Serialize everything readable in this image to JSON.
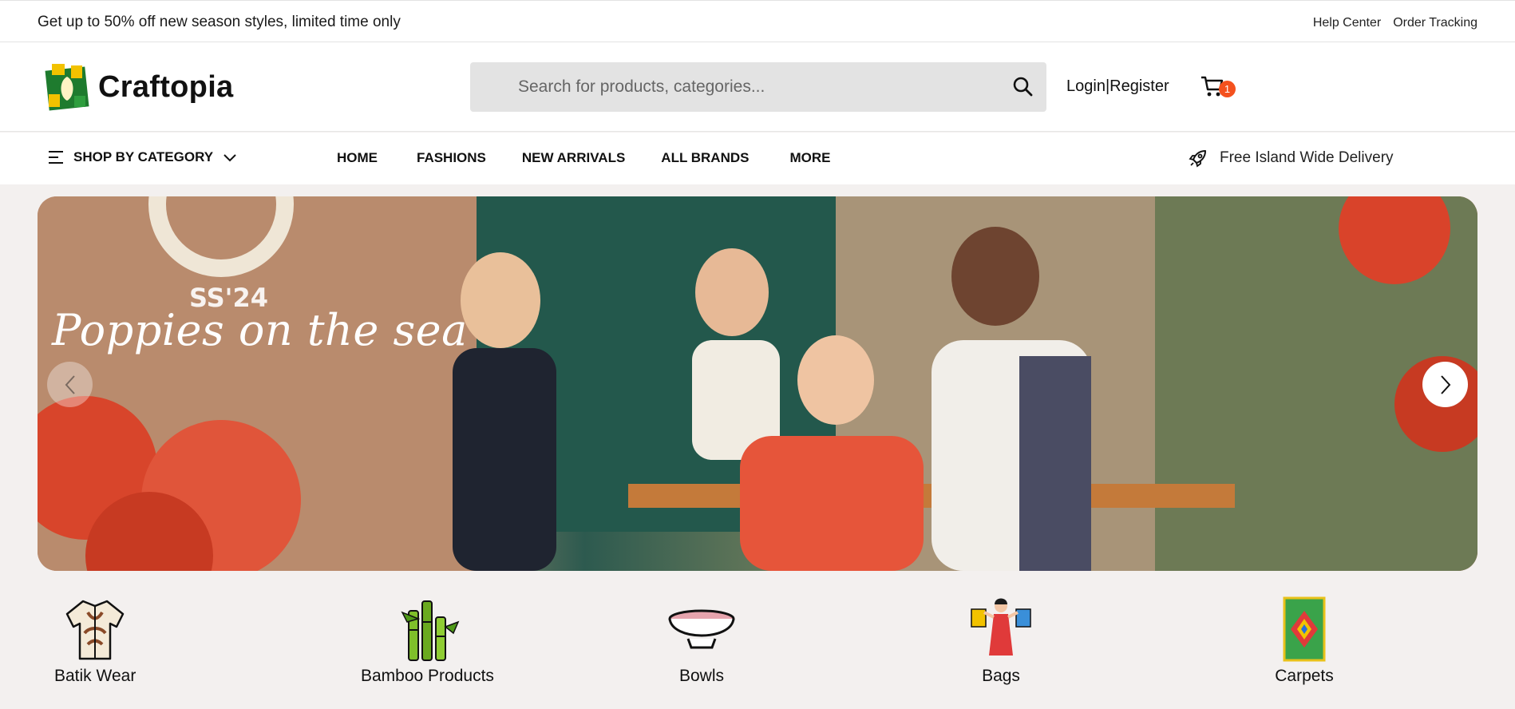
{
  "topbar": {
    "promo": "Get up to 50% off new season styles, limited time only",
    "links": [
      "Help Center",
      "Order Tracking"
    ]
  },
  "header": {
    "brand": "Craftopia",
    "search_placeholder": "Search for products, categories...",
    "login": "Login",
    "separator": "|",
    "register": "Register",
    "cart_count": "1"
  },
  "nav": {
    "shop_by_category": "SHOP BY CATEGORY",
    "links": [
      "HOME",
      "FASHIONS",
      "NEW ARRIVALS",
      "ALL BRANDS",
      "MORE"
    ],
    "delivery": "Free Island Wide Delivery"
  },
  "hero": {
    "subtitle": "SS'24",
    "title": "Poppies on the sea"
  },
  "categories": [
    {
      "label": "Batik Wear",
      "icon": "batik-shirt-icon"
    },
    {
      "label": "Bamboo Products",
      "icon": "bamboo-icon"
    },
    {
      "label": "Bowls",
      "icon": "bowl-icon"
    },
    {
      "label": "Bags",
      "icon": "bags-icon"
    },
    {
      "label": "Carpets",
      "icon": "carpet-icon"
    }
  ],
  "colors": {
    "accent": "#f4511e",
    "search_bg": "#e3e3e3",
    "page_bg": "#f3f0ef"
  }
}
